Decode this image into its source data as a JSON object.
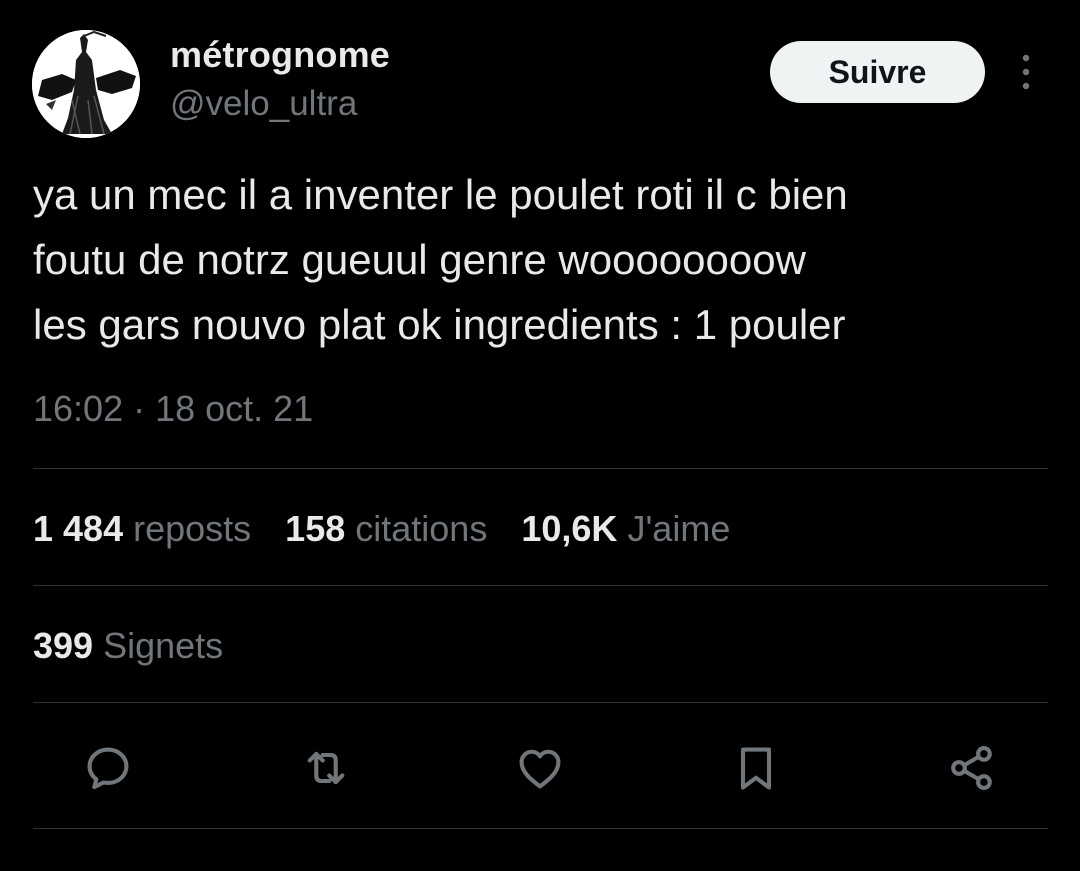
{
  "user": {
    "display_name": "métrognome",
    "handle": "@velo_ultra"
  },
  "header": {
    "follow_label": "Suivre"
  },
  "tweet": {
    "lines": [
      "ya un mec il a inventer le poulet roti il c bien",
      "foutu de notrz gueuul genre woooooooow",
      "les gars nouvo plat ok ingredients : 1 pouler"
    ],
    "timestamp": "16:02 · 18 oct. 21"
  },
  "stats": {
    "reposts": {
      "num": "1 484",
      "label": "reposts"
    },
    "quotes": {
      "num": "158",
      "label": "citations"
    },
    "likes": {
      "num": "10,6K",
      "label": "J'aime"
    },
    "bookmarks": {
      "num": "399",
      "label": "Signets"
    }
  },
  "icons": {
    "reply": "reply-icon",
    "repost": "repost-icon",
    "like": "heart-icon",
    "bookmark": "bookmark-icon",
    "share": "share-icon",
    "more": "more-vertical-icon"
  },
  "colors": {
    "background": "#000000",
    "text": "#e7e9ea",
    "secondary": "#71767b",
    "divider": "#2f3336",
    "button_bg": "#eff3f4"
  }
}
